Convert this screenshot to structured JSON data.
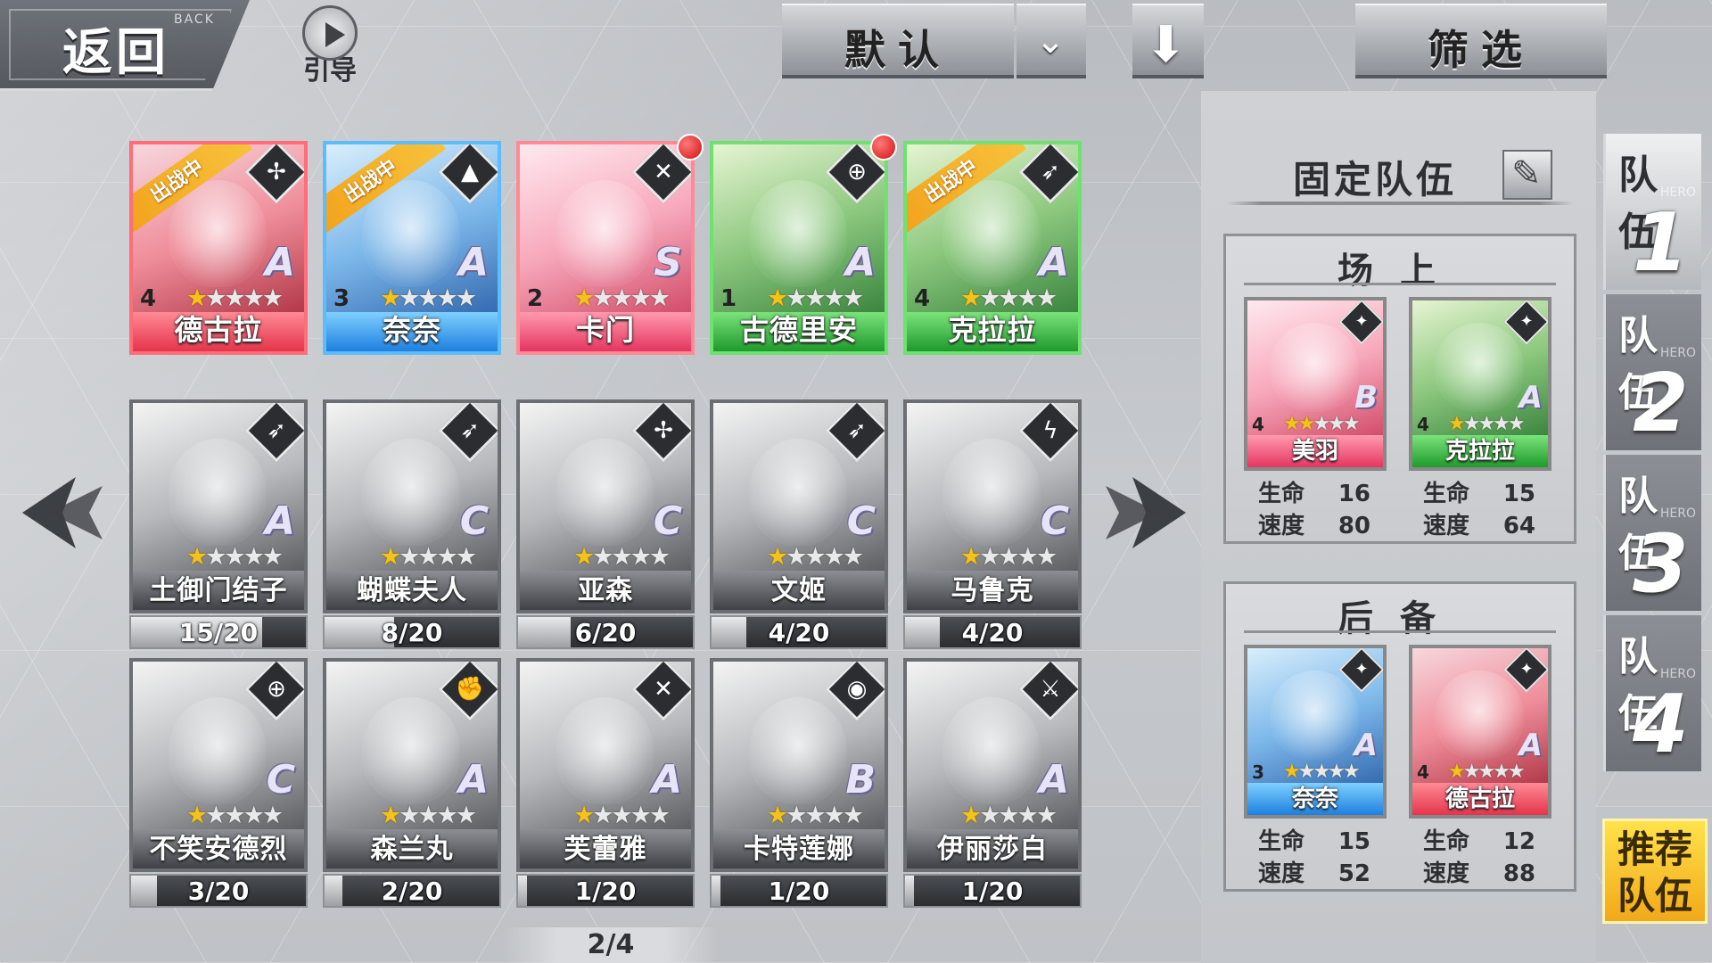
{
  "topbar": {
    "back_label": "返回",
    "back_sub": "BACK",
    "guide_label": "引导",
    "sort_label": "默认",
    "filter_label": "筛选"
  },
  "colors": {
    "red": "#e4344b",
    "blue": "#1e7fde",
    "green": "#1f9a2c",
    "pink": "#e53560",
    "gray": "#3f4146",
    "gold": "#f4c31a"
  },
  "deployed": [
    {
      "name": "德古拉",
      "level": "4",
      "stars": 1,
      "rank": "A",
      "theme": "red",
      "class_icon": "shuriken-icon",
      "ribbon": "出战中",
      "alert": false
    },
    {
      "name": "奈奈",
      "level": "3",
      "stars": 1,
      "rank": "A",
      "theme": "blue",
      "class_icon": "wizard-hat-icon",
      "ribbon": "出战中",
      "alert": false
    },
    {
      "name": "卡门",
      "level": "2",
      "stars": 1,
      "rank": "S",
      "theme": "pink",
      "class_icon": "mask-icon",
      "ribbon": "",
      "alert": true
    },
    {
      "name": "古德里安",
      "level": "1",
      "stars": 1,
      "rank": "A",
      "theme": "green",
      "class_icon": "crosshair-icon",
      "ribbon": "",
      "alert": true
    },
    {
      "name": "克拉拉",
      "level": "4",
      "stars": 1,
      "rank": "A",
      "theme": "green",
      "class_icon": "bow-icon",
      "ribbon": "出战中",
      "alert": false
    }
  ],
  "locked_row1": [
    {
      "name": "土御门结子",
      "rank": "A",
      "class_icon": "bow-icon",
      "progress": "15/20",
      "fraction": 0.75
    },
    {
      "name": "蝴蝶夫人",
      "rank": "C",
      "class_icon": "bow-icon",
      "progress": "8/20",
      "fraction": 0.4
    },
    {
      "name": "亚森",
      "rank": "C",
      "class_icon": "shuriken-icon",
      "progress": "6/20",
      "fraction": 0.3
    },
    {
      "name": "文姬",
      "rank": "C",
      "class_icon": "bow-icon",
      "progress": "4/20",
      "fraction": 0.2
    },
    {
      "name": "马鲁克",
      "rank": "C",
      "class_icon": "lightning-icon",
      "progress": "4/20",
      "fraction": 0.2
    }
  ],
  "locked_row2": [
    {
      "name": "不笑安德烈",
      "rank": "C",
      "class_icon": "crosshair-icon",
      "progress": "3/20",
      "fraction": 0.15
    },
    {
      "name": "森兰丸",
      "rank": "A",
      "class_icon": "fist-icon",
      "progress": "2/20",
      "fraction": 0.1
    },
    {
      "name": "芙蕾雅",
      "rank": "A",
      "class_icon": "mask-icon",
      "progress": "1/20",
      "fraction": 0.05
    },
    {
      "name": "卡特莲娜",
      "rank": "B",
      "class_icon": "eye-icon",
      "progress": "1/20",
      "fraction": 0.05
    },
    {
      "name": "伊丽莎白",
      "rank": "A",
      "class_icon": "sword-icon",
      "progress": "1/20",
      "fraction": 0.05
    }
  ],
  "page_indicator": "2/4",
  "panel": {
    "title": "固定队伍",
    "field_label": "场上",
    "reserve_label": "后备",
    "stat_hp": "生命",
    "stat_speed": "速度",
    "field": [
      {
        "name": "美羽",
        "level": "4",
        "stars": 2,
        "rank": "B",
        "theme": "pink",
        "hp": "16",
        "speed": "80"
      },
      {
        "name": "克拉拉",
        "level": "4",
        "stars": 1,
        "rank": "A",
        "theme": "green",
        "hp": "15",
        "speed": "64"
      }
    ],
    "reserve": [
      {
        "name": "奈奈",
        "level": "3",
        "stars": 1,
        "rank": "A",
        "theme": "blue",
        "hp": "15",
        "speed": "52"
      },
      {
        "name": "德古拉",
        "level": "4",
        "stars": 1,
        "rank": "A",
        "theme": "red",
        "hp": "12",
        "speed": "88"
      }
    ]
  },
  "team_tabs": [
    {
      "label": "队伍",
      "sub": "HERO",
      "num": "1",
      "active": true
    },
    {
      "label": "队伍",
      "sub": "HERO",
      "num": "2",
      "active": false
    },
    {
      "label": "队伍",
      "sub": "HERO",
      "num": "3",
      "active": false
    },
    {
      "label": "队伍",
      "sub": "HERO",
      "num": "4",
      "active": false
    }
  ],
  "recommend_label_1": "推荐",
  "recommend_label_2": "队伍"
}
